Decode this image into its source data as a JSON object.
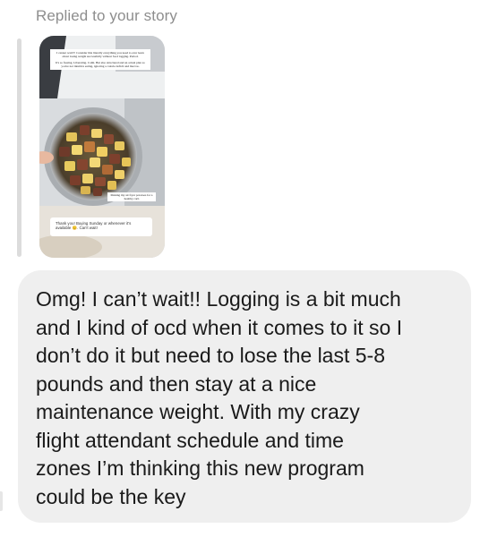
{
  "header": {
    "replied_label": "Replied to your story"
  },
  "story": {
    "top_text_1": "I cannot wait!!! Consider this literally everything you need to ever learn about losing weight successfully without food logging. Period.",
    "top_text_2": "It's so freeing. Liberating. Calm. But also structured and an actual plan so you're not intuitive eating, ignoring a calorie deficit and macros.",
    "caption": "Making my air fryer potatoes for a healthy carb",
    "reply_text": "Thank you! Buying Sunday or whenever it's available 😊. Can't wait!"
  },
  "message": {
    "text": "Omg! I can’t wait!! Logging is a bit much\nand I kind of ocd when it comes to it so I\ndon’t do it but need to lose the last 5-8\npounds and then stay at a nice\nmaintenance weight. With my crazy\nflight attendant schedule and time\nzones I’m thinking this new program\ncould be the key"
  }
}
